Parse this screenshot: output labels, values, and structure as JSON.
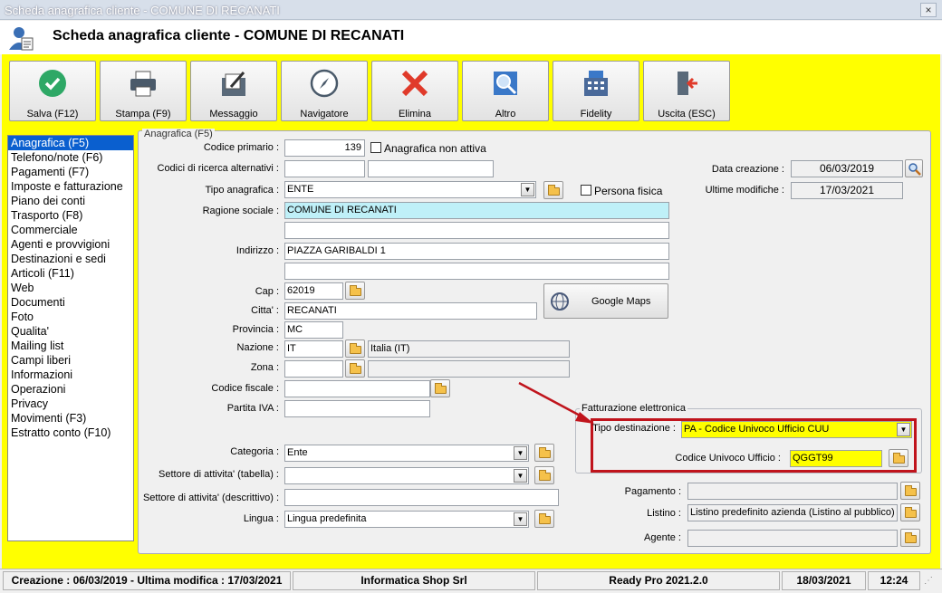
{
  "window": {
    "title": "Scheda anagrafica cliente - COMUNE DI RECANATI",
    "close": "×"
  },
  "header": {
    "title": "Scheda anagrafica cliente - COMUNE DI RECANATI"
  },
  "toolbar": [
    {
      "label": "Salva (F12)",
      "icon": "check-icon"
    },
    {
      "label": "Stampa (F9)",
      "icon": "printer-icon"
    },
    {
      "label": "Messaggio",
      "icon": "message-icon"
    },
    {
      "label": "Navigatore",
      "icon": "compass-icon"
    },
    {
      "label": "Elimina",
      "icon": "delete-icon"
    },
    {
      "label": "Altro",
      "icon": "magnifier-icon"
    },
    {
      "label": "Fidelity",
      "icon": "cash-register-icon"
    },
    {
      "label": "Uscita (ESC)",
      "icon": "exit-icon"
    }
  ],
  "nav": [
    "Anagrafica (F5)",
    "Telefono/note (F6)",
    "Pagamenti (F7)",
    "Imposte e fatturazione",
    "Piano dei conti",
    "Trasporto (F8)",
    "Commerciale",
    "Agenti e provvigioni",
    "Destinazioni e sedi",
    "Articoli (F11)",
    "Web",
    "Documenti",
    "Foto",
    "Qualita'",
    "Mailing list",
    "Campi liberi",
    "Informazioni",
    "Operazioni",
    "Privacy",
    "Movimenti (F3)",
    "Estratto conto (F10)"
  ],
  "panel": {
    "title": "Anagrafica (F5)"
  },
  "labels": {
    "codice_primario": "Codice primario :",
    "codici_ricerca": "Codici di ricerca alternativi :",
    "tipo_anagrafica": "Tipo anagrafica :",
    "ragione_sociale": "Ragione sociale :",
    "indirizzo": "Indirizzo :",
    "cap": "Cap :",
    "citta": "Citta' :",
    "provincia": "Provincia :",
    "nazione": "Nazione :",
    "zona": "Zona :",
    "codice_fiscale": "Codice fiscale :",
    "partita_iva": "Partita IVA :",
    "categoria": "Categoria :",
    "settore_tabella": "Settore di attivita' (tabella) :",
    "settore_descrittivo": "Settore di attivita' (descrittivo) :",
    "lingua": "Lingua :",
    "data_creazione": "Data creazione :",
    "ultime_modifiche": "Ultime modifiche :",
    "anagrafica_non_attiva": "Anagrafica non attiva",
    "persona_fisica": "Persona fisica",
    "fe_group": "Fatturazione elettronica",
    "tipo_destinazione": "Tipo destinazione :",
    "codice_univoco": "Codice Univoco Ufficio :",
    "pagamento": "Pagamento :",
    "listino": "Listino :",
    "agente": "Agente :"
  },
  "values": {
    "codice_primario": "139",
    "tipo_anagrafica": "ENTE",
    "ragione_sociale": "COMUNE DI RECANATI",
    "indirizzo": "PIAZZA GARIBALDI 1",
    "cap": "62019",
    "citta": "RECANATI",
    "provincia": "MC",
    "nazione": "IT",
    "nazione_desc": "Italia (IT)",
    "categoria": "Ente",
    "lingua": "Lingua predefinita",
    "data_creazione": "06/03/2019",
    "ultime_modifiche": "17/03/2021",
    "tipo_destinazione": "PA - Codice Univoco Ufficio CUU",
    "codice_univoco": "QGGT99",
    "listino": "Listino predefinito azienda (Listino al pubblico)",
    "google_maps": "Google Maps"
  },
  "status": {
    "dates": "Creazione : 06/03/2019 - Ultima modifica : 17/03/2021",
    "company": "Informatica Shop Srl",
    "product": "Ready Pro 2021.2.0",
    "date": "18/03/2021",
    "time": "12:24"
  },
  "colors": {
    "highlight": "#ffff00",
    "annotation": "#c0141c",
    "selection": "#0a5fcf"
  }
}
